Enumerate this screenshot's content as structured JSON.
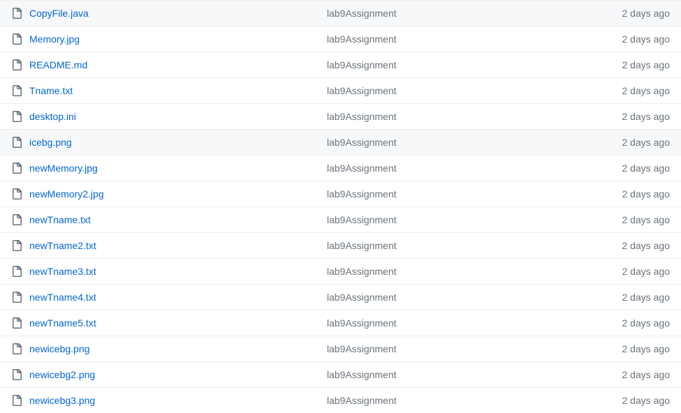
{
  "files": [
    {
      "name": "CopyFile.java",
      "commit": "lab9Assignment",
      "age": "2 days ago",
      "highlighted": false
    },
    {
      "name": "Memory.jpg",
      "commit": "lab9Assignment",
      "age": "2 days ago",
      "highlighted": false
    },
    {
      "name": "README.md",
      "commit": "lab9Assignment",
      "age": "2 days ago",
      "highlighted": false
    },
    {
      "name": "Tname.txt",
      "commit": "lab9Assignment",
      "age": "2 days ago",
      "highlighted": false
    },
    {
      "name": "desktop.ini",
      "commit": "lab9Assignment",
      "age": "2 days ago",
      "highlighted": false
    },
    {
      "name": "icebg.png",
      "commit": "lab9Assignment",
      "age": "2 days ago",
      "highlighted": true
    },
    {
      "name": "newMemory.jpg",
      "commit": "lab9Assignment",
      "age": "2 days ago",
      "highlighted": false
    },
    {
      "name": "newMemory2.jpg",
      "commit": "lab9Assignment",
      "age": "2 days ago",
      "highlighted": false
    },
    {
      "name": "newTname.txt",
      "commit": "lab9Assignment",
      "age": "2 days ago",
      "highlighted": false
    },
    {
      "name": "newTname2.txt",
      "commit": "lab9Assignment",
      "age": "2 days ago",
      "highlighted": false
    },
    {
      "name": "newTname3.txt",
      "commit": "lab9Assignment",
      "age": "2 days ago",
      "highlighted": false
    },
    {
      "name": "newTname4.txt",
      "commit": "lab9Assignment",
      "age": "2 days ago",
      "highlighted": false
    },
    {
      "name": "newTname5.txt",
      "commit": "lab9Assignment",
      "age": "2 days ago",
      "highlighted": false
    },
    {
      "name": "newicebg.png",
      "commit": "lab9Assignment",
      "age": "2 days ago",
      "highlighted": false
    },
    {
      "name": "newicebg2.png",
      "commit": "lab9Assignment",
      "age": "2 days ago",
      "highlighted": false
    },
    {
      "name": "newicebg3.png",
      "commit": "lab9Assignment",
      "age": "2 days ago",
      "highlighted": false
    }
  ]
}
